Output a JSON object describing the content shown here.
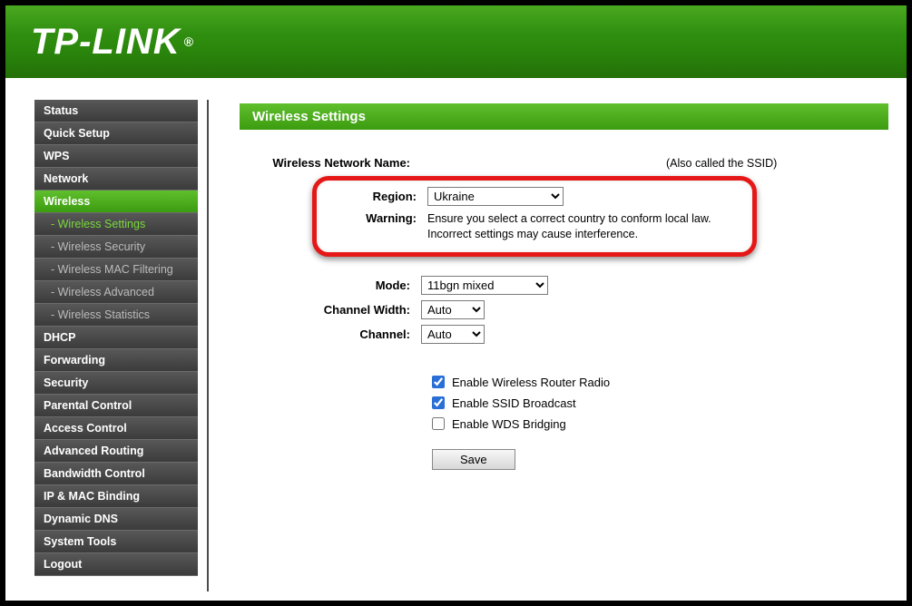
{
  "brand": "TP-LINK",
  "menu": {
    "status": "Status",
    "quick_setup": "Quick Setup",
    "wps": "WPS",
    "network": "Network",
    "wireless": "Wireless",
    "wireless_settings": "- Wireless Settings",
    "wireless_security": "- Wireless Security",
    "wireless_mac": "- Wireless MAC Filtering",
    "wireless_advanced": "- Wireless Advanced",
    "wireless_statistics": "- Wireless Statistics",
    "dhcp": "DHCP",
    "forwarding": "Forwarding",
    "security": "Security",
    "parental": "Parental Control",
    "access": "Access Control",
    "adv_routing": "Advanced Routing",
    "bandwidth": "Bandwidth Control",
    "ipmac": "IP & MAC Binding",
    "ddns": "Dynamic DNS",
    "systools": "System Tools",
    "logout": "Logout"
  },
  "page": {
    "title": "Wireless Settings",
    "ssid_label": "Wireless Network Name:",
    "ssid_hint": "(Also called the SSID)",
    "region_label": "Region:",
    "region_value": "Ukraine",
    "warning_label": "Warning:",
    "warning_text_line1": "Ensure you select a correct country to conform local law.",
    "warning_text_line2": "Incorrect settings may cause interference.",
    "mode_label": "Mode:",
    "mode_value": "11bgn mixed",
    "chwidth_label": "Channel Width:",
    "chwidth_value": "Auto",
    "channel_label": "Channel:",
    "channel_value": "Auto",
    "chk_radio": "Enable Wireless Router Radio",
    "chk_ssid": "Enable SSID Broadcast",
    "chk_wds": "Enable WDS Bridging",
    "save": "Save"
  },
  "checked": {
    "radio": true,
    "ssid": true,
    "wds": false
  }
}
